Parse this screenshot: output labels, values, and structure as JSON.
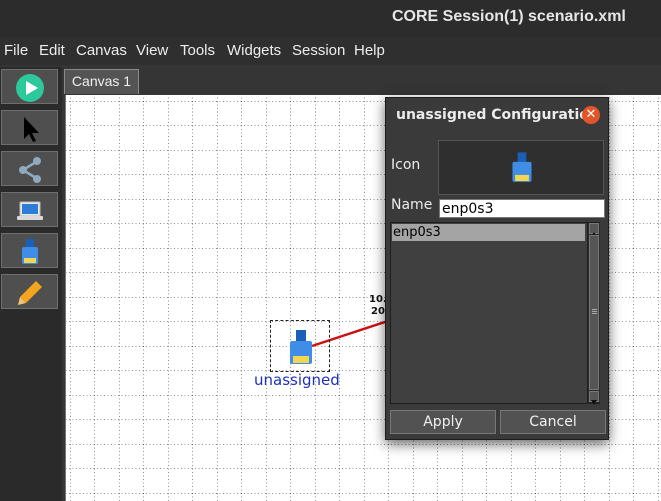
{
  "window": {
    "title": "CORE Session(1) scenario.xml"
  },
  "menu": {
    "items": [
      "File",
      "Edit",
      "Canvas",
      "View",
      "Tools",
      "Widgets",
      "Session",
      "Help"
    ]
  },
  "toolbar": {
    "tools": [
      "play-icon",
      "select-cursor-icon",
      "link-icon",
      "laptop-icon",
      "ethernet-port-icon",
      "pencil-icon"
    ]
  },
  "tabs": [
    {
      "label": "Canvas 1"
    }
  ],
  "canvas": {
    "node": {
      "label": "unassigned",
      "icon": "ethernet-port-icon"
    },
    "link": {
      "label_line1": "10.",
      "label_line2": "20"
    }
  },
  "dialog": {
    "title": "unassigned Configuration",
    "close_symbol": "✕",
    "icon_label": "Icon",
    "name_label": "Name",
    "name_value": "enp0s3",
    "list_items": [
      "enp0s3"
    ],
    "apply_label": "Apply",
    "cancel_label": "Cancel"
  },
  "colors": {
    "accent_close": "#e1552a",
    "node_label": "#1f2fbd",
    "link": "#cc1111",
    "play": "#2dc99b"
  }
}
